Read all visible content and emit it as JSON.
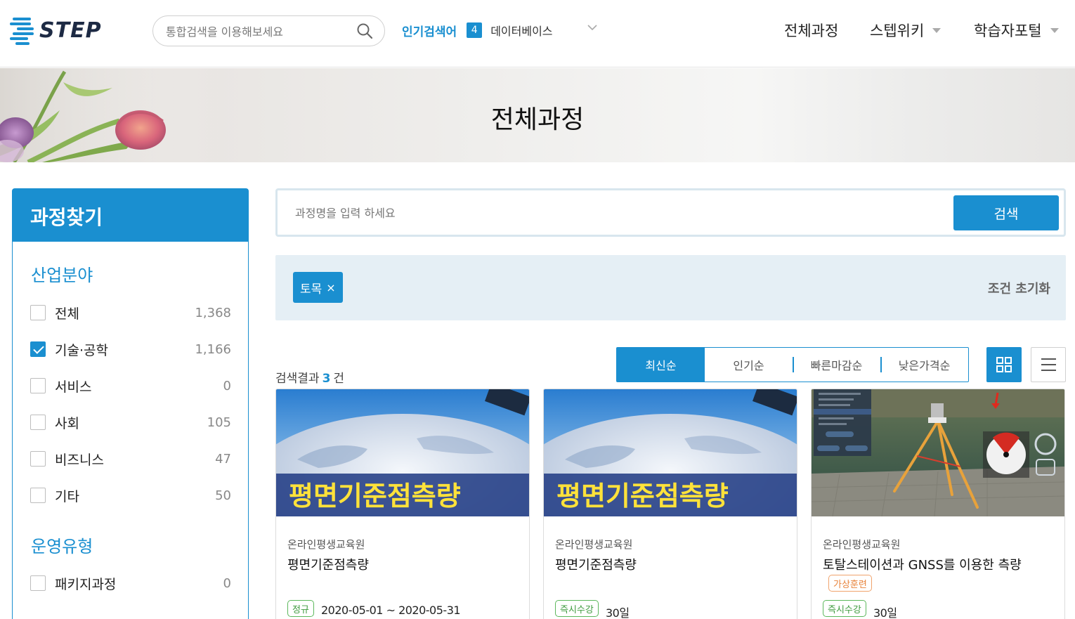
{
  "header": {
    "logo_text": "STEP",
    "search_placeholder": "통합검색을 이용해보세요",
    "popular_label": "인기검색어",
    "popular_rank": "4",
    "popular_term": "데이터베이스",
    "nav": [
      {
        "label": "전체과정",
        "has_dropdown": false
      },
      {
        "label": "스텝위키",
        "has_dropdown": true
      },
      {
        "label": "학습자포털",
        "has_dropdown": true
      }
    ]
  },
  "banner": {
    "title": "전체과정"
  },
  "sidebar": {
    "title": "과정찾기",
    "sections": [
      {
        "title": "산업분야",
        "items": [
          {
            "label": "전체",
            "count": "1,368",
            "checked": false
          },
          {
            "label": "기술·공학",
            "count": "1,166",
            "checked": true
          },
          {
            "label": "서비스",
            "count": "0",
            "checked": false
          },
          {
            "label": "사회",
            "count": "105",
            "checked": false
          },
          {
            "label": "비즈니스",
            "count": "47",
            "checked": false
          },
          {
            "label": "기타",
            "count": "50",
            "checked": false
          }
        ]
      },
      {
        "title": "운영유형",
        "items": [
          {
            "label": "패키지과정",
            "count": "0",
            "checked": false
          }
        ]
      }
    ]
  },
  "course_search": {
    "placeholder": "과정명을 입력 하세요",
    "button_label": "검색"
  },
  "filters": {
    "chips": [
      {
        "label": "토목",
        "close": "×"
      }
    ],
    "reset_label": "조건 초기화"
  },
  "results": {
    "prefix": "검색결과",
    "count": "3",
    "suffix": "건"
  },
  "sort": {
    "options": [
      "최신순",
      "인기순",
      "빠른마감순",
      "낮은가격순"
    ],
    "active": "최신순"
  },
  "view": {
    "active": "grid"
  },
  "cards": [
    {
      "thumb_type": "globe",
      "thumb_text": "평면기준점측량",
      "org": "온라인평생교육원",
      "title": "평면기준점측량",
      "badges": [
        {
          "label": "정규",
          "color": "green"
        }
      ],
      "date": "2020-05-01 ~ 2020-05-31"
    },
    {
      "thumb_type": "globe",
      "thumb_text": "평면기준점측량",
      "org": "온라인평생교육원",
      "title": "평면기준점측량",
      "badges": [
        {
          "label": "즉시수강",
          "color": "green"
        }
      ],
      "date": "30일"
    },
    {
      "thumb_type": "simulation",
      "thumb_text": "",
      "org": "온라인평생교육원",
      "title": "토탈스테이션과 GNSS를 이용한 측량",
      "tag": {
        "label": "가상훈련",
        "color": "orange"
      },
      "badges": [
        {
          "label": "즉시수강",
          "color": "green"
        }
      ],
      "date": "30일"
    }
  ],
  "colors": {
    "accent": "#1a8fd0",
    "filter_bg": "#e5eff5",
    "badge_green": "#5cb85c",
    "badge_orange": "#f0a36c"
  }
}
